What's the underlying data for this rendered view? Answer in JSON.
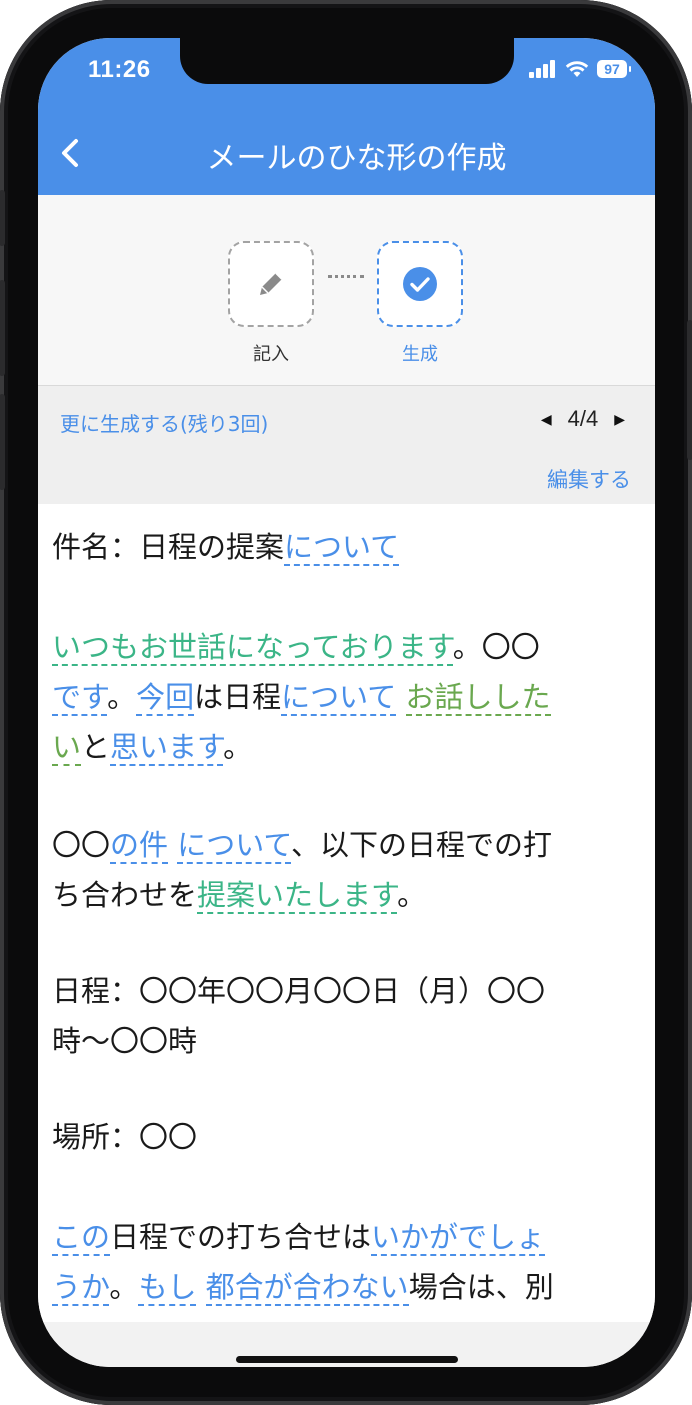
{
  "status": {
    "time": "11:26",
    "battery": "97"
  },
  "nav": {
    "title": "メールのひな形の作成"
  },
  "steps": [
    {
      "label": "記入",
      "icon": "pencil-icon"
    },
    {
      "label": "生成",
      "icon": "check-circle-icon"
    }
  ],
  "toolbar": {
    "more_label": "更に生成する(残り3回)",
    "page": "4/4",
    "edit_label": "編集する"
  },
  "email": {
    "subject": {
      "prefix": "件名：日程の提案",
      "link": "について"
    },
    "p1": {
      "greeting": "いつもお世話になっております",
      "after_greeting": "。〇〇",
      "desu": "です",
      "s1": "。",
      "konkai": "今回",
      "s2": "は日程",
      "nitsuite": "について",
      "ohanashi_a": "お話しした",
      "ohanashi_b": "い",
      "s3": "と",
      "omoimasu": "思います",
      "s4": "。"
    },
    "p2": {
      "lead": "〇〇",
      "noken": "の件",
      "nitsuite": "について",
      "rest1": "、以下の日程での打",
      "rest2": "ち合わせを",
      "teian": "提案いたします",
      "end": "。"
    },
    "p3": {
      "line1": "日程：〇〇年〇〇月〇〇日（月）〇〇",
      "line2": "時〜〇〇時"
    },
    "p4": {
      "line1": "場所：〇〇"
    },
    "p5": {
      "kono": "この",
      "s1": "日程での打ち合せは",
      "ikaga_a": "いかがでしょ",
      "ikaga_b": "うか",
      "s2": "。",
      "moshi": "もし",
      "tsugou": "都合が合わない",
      "s3": "場合は、別"
    }
  },
  "colors": {
    "primary": "#4a8fe8",
    "teal": "#3bb587",
    "green": "#6aa84f"
  }
}
